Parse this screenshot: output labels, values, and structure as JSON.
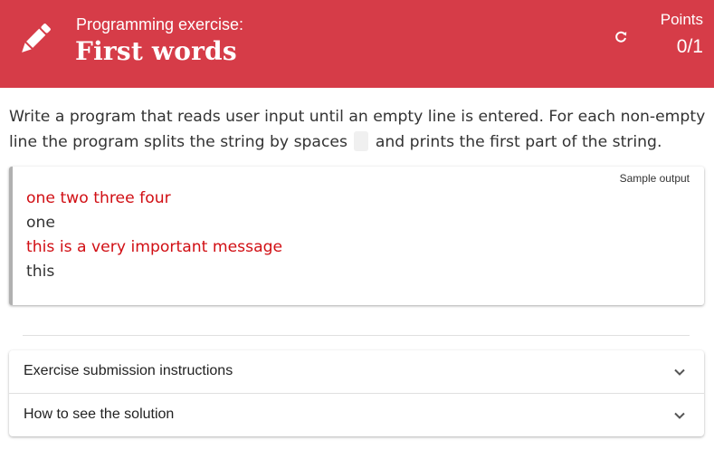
{
  "header": {
    "subtitle": "Programming exercise:",
    "title": "First words",
    "points_label": "Points",
    "points_value": "0/1",
    "pencil_icon": "pencil-icon",
    "refresh_icon": "refresh-icon",
    "background_color": "#d63c48"
  },
  "intro": {
    "text_before_chip": "Write a program that reads user input until an empty line is entered. For each non-empty line the program splits the string by spaces ",
    "text_after_chip": " and prints the first part of the string."
  },
  "sample": {
    "label": "Sample output",
    "lines": [
      {
        "text": "one two three four",
        "kind": "input"
      },
      {
        "text": "one",
        "kind": "output"
      },
      {
        "text": "this is a very important message",
        "kind": "input"
      },
      {
        "text": "this",
        "kind": "output"
      }
    ],
    "input_color": "#d10f14"
  },
  "accordion": {
    "items": [
      {
        "label": "Exercise submission instructions",
        "icon": "chevron-down-icon"
      },
      {
        "label": "How to see the solution",
        "icon": "chevron-down-icon"
      }
    ]
  }
}
